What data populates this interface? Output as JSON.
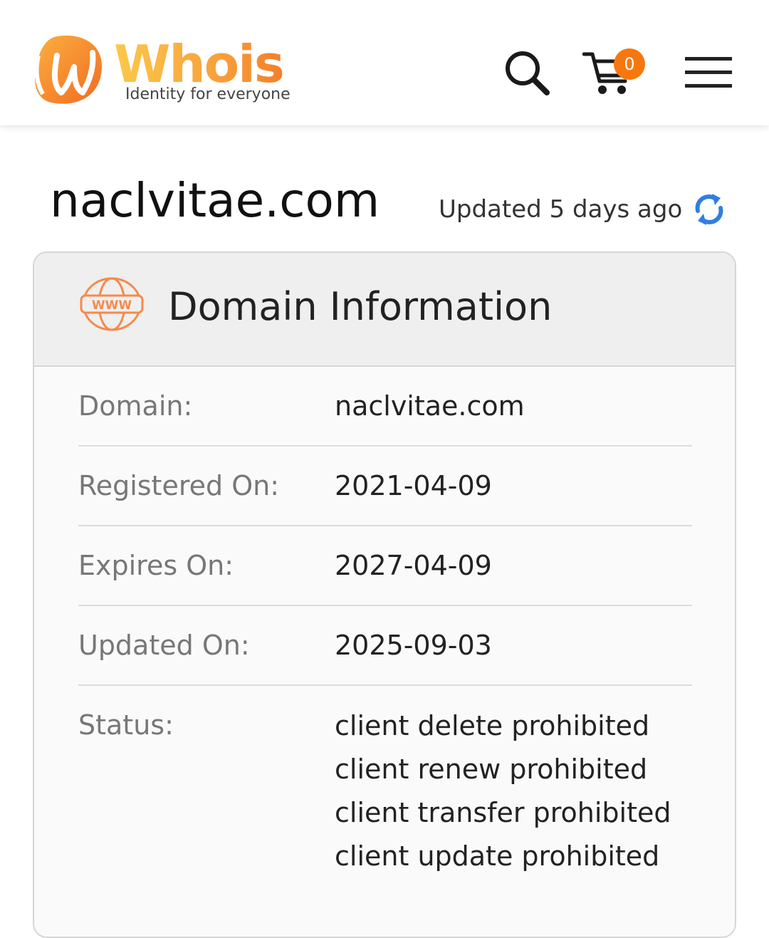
{
  "header": {
    "logo_word": "Whois",
    "logo_tagline": "Identity for everyone",
    "cart_count": "0",
    "icons": [
      "search-icon",
      "cart-icon",
      "hamburger-menu-icon"
    ],
    "colors": {
      "brand_orange": "#f47f2a",
      "brand_yellow": "#fbc94a",
      "badge": "#f7770f",
      "refresh_blue": "#2f7fe0"
    }
  },
  "page": {
    "domain": "naclvitae.com",
    "updated_text": "Updated 5 days ago"
  },
  "card": {
    "title": "Domain Information",
    "rows": [
      {
        "label": "Domain:",
        "value": "naclvitae.com"
      },
      {
        "label": "Registered On:",
        "value": "2021-04-09"
      },
      {
        "label": "Expires On:",
        "value": "2027-04-09"
      },
      {
        "label": "Updated On:",
        "value": "2025-09-03"
      }
    ],
    "status": {
      "label": "Status:",
      "values": [
        "client delete prohibited",
        "client renew prohibited",
        "client transfer prohibited",
        "client update prohibited"
      ]
    }
  }
}
